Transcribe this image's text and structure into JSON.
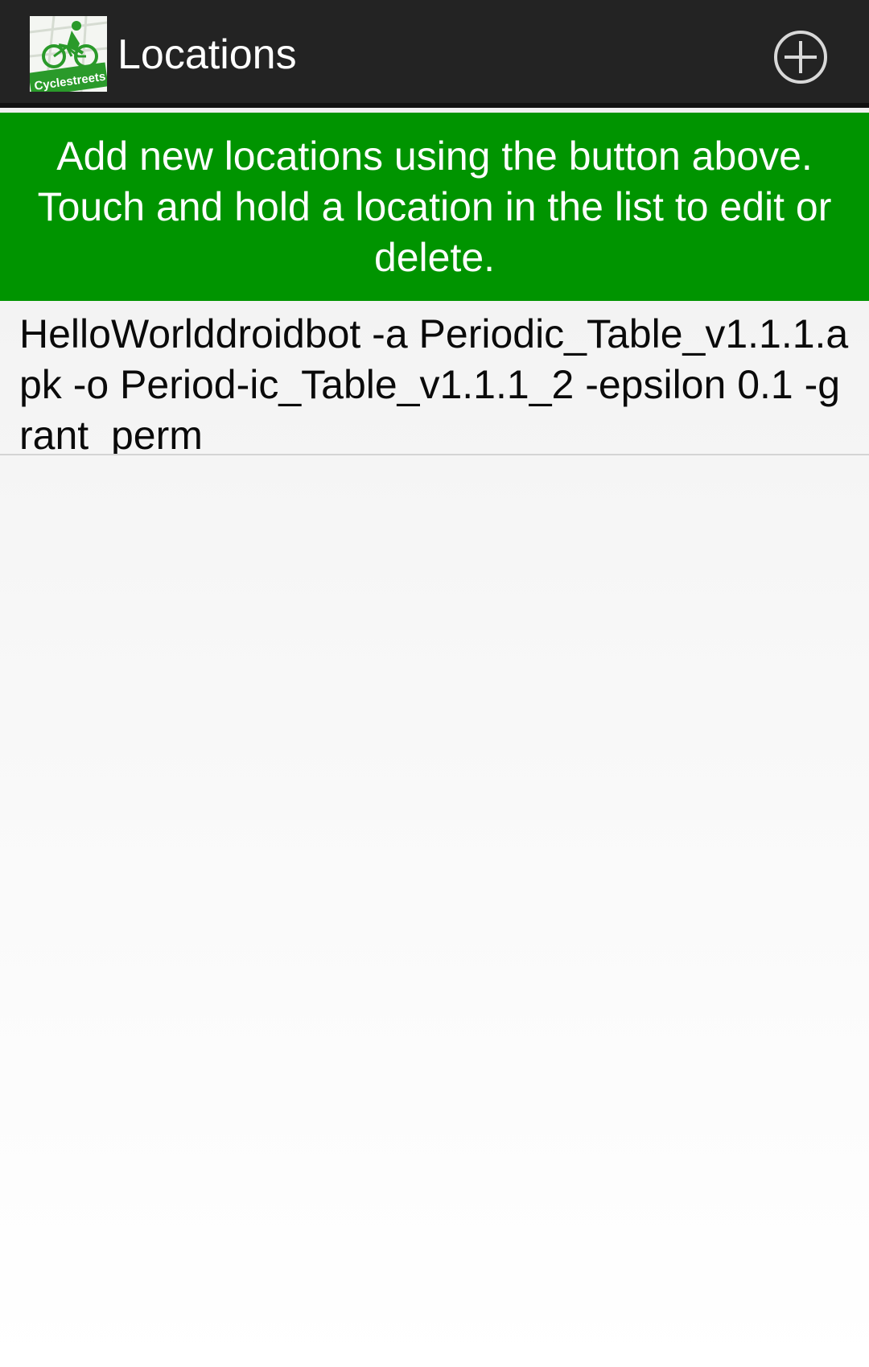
{
  "header": {
    "app_icon": "cyclestreets-logo-icon",
    "app_icon_text": "Cyclestreets",
    "title": "Locations",
    "add_icon": "add-circle-icon"
  },
  "banner": {
    "text": "Add new locations using the button above. Touch and hold a location in the list to edit or delete."
  },
  "locations": [
    {
      "label": "HelloWorlddroidbot -a Periodic_Table_v1.1.1.apk -o Period-ic_Table_v1.1.1_2 -epsilon 0.1 -grant_perm"
    }
  ],
  "colors": {
    "action_bar": "#232323",
    "banner": "#009400",
    "brand_green": "#2a9a2a"
  }
}
